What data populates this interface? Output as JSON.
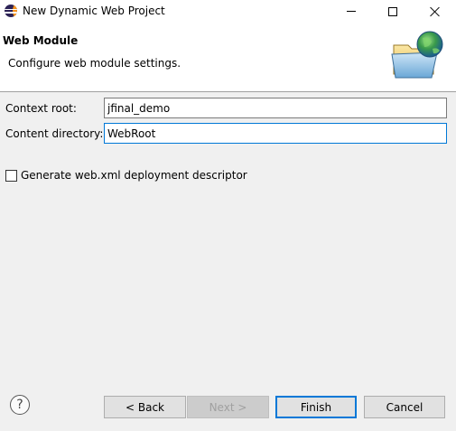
{
  "window": {
    "title": "New Dynamic Web Project"
  },
  "banner": {
    "title": "Web Module",
    "description": "Configure web module settings.",
    "image_icon": "folder-globe-icon"
  },
  "form": {
    "context_root_label": "Context root:",
    "context_root_value": "jfinal_demo",
    "content_directory_label": "Content directory:",
    "content_directory_value": "WebRoot",
    "generate_descriptor_label": "Generate web.xml deployment descriptor",
    "generate_descriptor_checked": false
  },
  "buttons": {
    "help_icon": "?",
    "back": "< Back",
    "next": "Next >",
    "finish": "Finish",
    "cancel": "Cancel"
  },
  "colors": {
    "accent": "#0078d7",
    "background": "#f0f0f0"
  }
}
